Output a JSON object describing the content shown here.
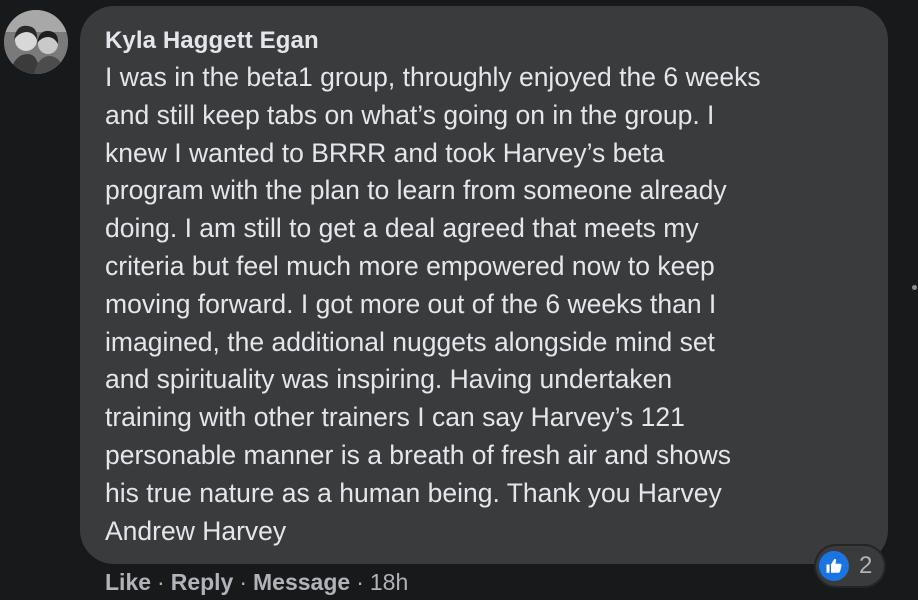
{
  "comment": {
    "author": "Kyla Haggett Egan",
    "text": "I was in the beta1 group, throughly enjoyed the 6 weeks\nand still keep tabs on what’s going on in the group. I\nknew I wanted to BRRR and took Harvey’s beta\nprogram with the plan to learn from someone already\ndoing. I am still to get a deal agreed that meets my\ncriteria but feel much more empowered now to keep\nmoving forward. I got more out of the 6 weeks than I\nimagined, the additional nuggets alongside mind set\nand spirituality was inspiring. Having undertaken\ntraining with other trainers I can say Harvey’s 121\npersonable manner is a breath of fresh air and shows\nhis true nature as a human being. Thank you Harvey\nAndrew Harvey",
    "reaction_icon": "thumbs-up-icon",
    "reaction_count": "2",
    "actions": {
      "like": "Like",
      "reply": "Reply",
      "message": "Message",
      "time": "18h",
      "separator": "·"
    }
  },
  "colors": {
    "page_background": "#18191a",
    "bubble_background": "#3a3b3c",
    "primary_text": "#e4e6eb",
    "secondary_text": "#b0b3b8",
    "like_blue": "#1b74e4"
  }
}
